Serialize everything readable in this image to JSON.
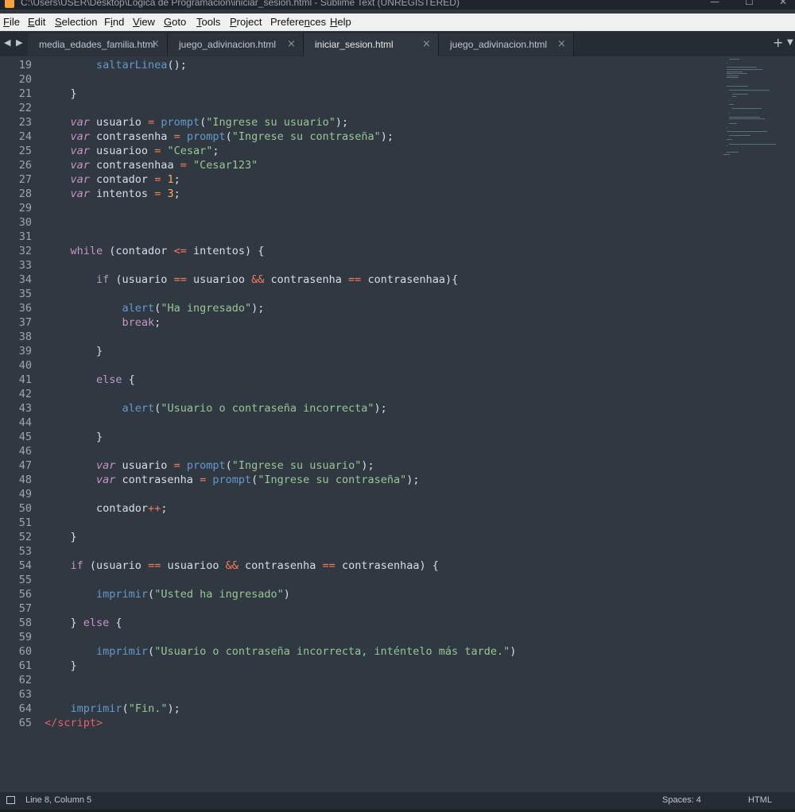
{
  "window": {
    "title": "C:\\Users\\USER\\Desktop\\Lógica de Programación\\iniciar_sesion.html - Sublime Text (UNREGISTERED)",
    "app_icon": "sublime-icon"
  },
  "menu": [
    {
      "ul": "F",
      "rest": "ile"
    },
    {
      "ul": "E",
      "rest": "dit"
    },
    {
      "ul": "S",
      "rest": "election"
    },
    {
      "ul": "",
      "rest": "F",
      "ul2": "i",
      "rest2": "nd"
    },
    {
      "ul": "V",
      "rest": "iew"
    },
    {
      "ul": "",
      "rest": "",
      "ul2": "G",
      "rest2": "oto"
    },
    {
      "ul": "T",
      "rest": "ools"
    },
    {
      "ul": "P",
      "rest": "roject"
    },
    {
      "ul": "",
      "rest": "Prefere",
      "ul2": "n",
      "rest2": "ces"
    },
    {
      "ul": "H",
      "rest": "elp"
    }
  ],
  "tabs": [
    {
      "label": "media_edades_familia.html",
      "active": false
    },
    {
      "label": "juego_adivinacion.html",
      "active": false
    },
    {
      "label": "iniciar_sesion.html",
      "active": true
    },
    {
      "label": "juego_adivinacion.html",
      "active": false
    }
  ],
  "tab_icons": {
    "prev": "◀",
    "next": "▶",
    "new": "+",
    "dropdown": "▼",
    "close": "×"
  },
  "code_lines": [
    {
      "n": "19",
      "t": [
        [
          "fn",
          "        saltarLinea"
        ],
        [
          "plain",
          "();"
        ]
      ]
    },
    {
      "n": "20",
      "t": []
    },
    {
      "n": "21",
      "t": [
        [
          "plain",
          "    }"
        ]
      ]
    },
    {
      "n": "22",
      "t": []
    },
    {
      "n": "23",
      "t": [
        [
          "kw",
          "    var"
        ],
        [
          "plain",
          " usuario "
        ],
        [
          "op",
          "="
        ],
        [
          "plain",
          " "
        ],
        [
          "fn",
          "prompt"
        ],
        [
          "plain",
          "("
        ],
        [
          "st",
          "\"Ingrese su usuario\""
        ],
        [
          "plain",
          ");"
        ]
      ]
    },
    {
      "n": "24",
      "t": [
        [
          "kw",
          "    var"
        ],
        [
          "plain",
          " contrasenha "
        ],
        [
          "op",
          "="
        ],
        [
          "plain",
          " "
        ],
        [
          "fn",
          "prompt"
        ],
        [
          "plain",
          "("
        ],
        [
          "st",
          "\"Ingrese su contraseña\""
        ],
        [
          "plain",
          ");"
        ]
      ]
    },
    {
      "n": "25",
      "t": [
        [
          "kw",
          "    var"
        ],
        [
          "plain",
          " usuarioo "
        ],
        [
          "op",
          "="
        ],
        [
          "plain",
          " "
        ],
        [
          "st",
          "\"Cesar\""
        ],
        [
          "plain",
          ";"
        ]
      ]
    },
    {
      "n": "26",
      "t": [
        [
          "kw",
          "    var"
        ],
        [
          "plain",
          " contrasenhaa "
        ],
        [
          "op",
          "="
        ],
        [
          "plain",
          " "
        ],
        [
          "st",
          "\"Cesar123\""
        ]
      ]
    },
    {
      "n": "27",
      "t": [
        [
          "kw",
          "    var"
        ],
        [
          "plain",
          " contador "
        ],
        [
          "op",
          "="
        ],
        [
          "plain",
          " "
        ],
        [
          "nm",
          "1"
        ],
        [
          "plain",
          ";"
        ]
      ]
    },
    {
      "n": "28",
      "t": [
        [
          "kw",
          "    var"
        ],
        [
          "plain",
          " intentos "
        ],
        [
          "op",
          "="
        ],
        [
          "plain",
          " "
        ],
        [
          "nm",
          "3"
        ],
        [
          "plain",
          ";"
        ]
      ]
    },
    {
      "n": "29",
      "t": []
    },
    {
      "n": "30",
      "t": []
    },
    {
      "n": "31",
      "t": []
    },
    {
      "n": "32",
      "t": [
        [
          "ctl",
          "    while"
        ],
        [
          "plain",
          " (contador "
        ],
        [
          "op",
          "<="
        ],
        [
          "plain",
          " intentos) {"
        ]
      ]
    },
    {
      "n": "33",
      "t": []
    },
    {
      "n": "34",
      "t": [
        [
          "ctl",
          "        if"
        ],
        [
          "plain",
          " (usuario "
        ],
        [
          "op",
          "=="
        ],
        [
          "plain",
          " usuarioo "
        ],
        [
          "op",
          "&&"
        ],
        [
          "plain",
          " contrasenha "
        ],
        [
          "op",
          "=="
        ],
        [
          "plain",
          " contrasenhaa){"
        ]
      ]
    },
    {
      "n": "35",
      "t": []
    },
    {
      "n": "36",
      "t": [
        [
          "fn",
          "            alert"
        ],
        [
          "plain",
          "("
        ],
        [
          "st",
          "\"Ha ingresado\""
        ],
        [
          "plain",
          ");"
        ]
      ]
    },
    {
      "n": "37",
      "t": [
        [
          "ctl",
          "            break"
        ],
        [
          "plain",
          ";"
        ]
      ]
    },
    {
      "n": "38",
      "t": []
    },
    {
      "n": "39",
      "t": [
        [
          "plain",
          "        }"
        ]
      ]
    },
    {
      "n": "40",
      "t": []
    },
    {
      "n": "41",
      "t": [
        [
          "ctl",
          "        else"
        ],
        [
          "plain",
          " {"
        ]
      ]
    },
    {
      "n": "42",
      "t": []
    },
    {
      "n": "43",
      "t": [
        [
          "fn",
          "            alert"
        ],
        [
          "plain",
          "("
        ],
        [
          "st",
          "\"Usuario o contraseña incorrecta\""
        ],
        [
          "plain",
          ");"
        ]
      ]
    },
    {
      "n": "44",
      "t": []
    },
    {
      "n": "45",
      "t": [
        [
          "plain",
          "        }"
        ]
      ]
    },
    {
      "n": "46",
      "t": []
    },
    {
      "n": "47",
      "t": [
        [
          "kw",
          "        var"
        ],
        [
          "plain",
          " usuario "
        ],
        [
          "op",
          "="
        ],
        [
          "plain",
          " "
        ],
        [
          "fn",
          "prompt"
        ],
        [
          "plain",
          "("
        ],
        [
          "st",
          "\"Ingrese su usuario\""
        ],
        [
          "plain",
          ");"
        ]
      ]
    },
    {
      "n": "48",
      "t": [
        [
          "kw",
          "        var"
        ],
        [
          "plain",
          " contrasenha "
        ],
        [
          "op",
          "="
        ],
        [
          "plain",
          " "
        ],
        [
          "fn",
          "prompt"
        ],
        [
          "plain",
          "("
        ],
        [
          "st",
          "\"Ingrese su contraseña\""
        ],
        [
          "plain",
          ");"
        ]
      ]
    },
    {
      "n": "49",
      "t": []
    },
    {
      "n": "50",
      "t": [
        [
          "plain",
          "        contador"
        ],
        [
          "op",
          "++"
        ],
        [
          "plain",
          ";"
        ]
      ]
    },
    {
      "n": "51",
      "t": []
    },
    {
      "n": "52",
      "t": [
        [
          "plain",
          "    }"
        ]
      ]
    },
    {
      "n": "53",
      "t": []
    },
    {
      "n": "54",
      "t": [
        [
          "ctl",
          "    if"
        ],
        [
          "plain",
          " (usuario "
        ],
        [
          "op",
          "=="
        ],
        [
          "plain",
          " usuarioo "
        ],
        [
          "op",
          "&&"
        ],
        [
          "plain",
          " contrasenha "
        ],
        [
          "op",
          "=="
        ],
        [
          "plain",
          " contrasenhaa) {"
        ]
      ]
    },
    {
      "n": "55",
      "t": []
    },
    {
      "n": "56",
      "t": [
        [
          "fn",
          "        imprimir"
        ],
        [
          "plain",
          "("
        ],
        [
          "st",
          "\"Usted ha ingresado\""
        ],
        [
          "plain",
          ")"
        ]
      ]
    },
    {
      "n": "57",
      "t": []
    },
    {
      "n": "58",
      "t": [
        [
          "plain",
          "    } "
        ],
        [
          "ctl",
          "else"
        ],
        [
          "plain",
          " {"
        ]
      ]
    },
    {
      "n": "59",
      "t": []
    },
    {
      "n": "60",
      "t": [
        [
          "fn",
          "        imprimir"
        ],
        [
          "plain",
          "("
        ],
        [
          "st",
          "\"Usuario o contraseña incorrecta, inténtelo más tarde.\""
        ],
        [
          "plain",
          ")"
        ]
      ]
    },
    {
      "n": "61",
      "t": [
        [
          "plain",
          "    }"
        ]
      ]
    },
    {
      "n": "62",
      "t": []
    },
    {
      "n": "63",
      "t": []
    },
    {
      "n": "64",
      "t": [
        [
          "fn",
          "    imprimir"
        ],
        [
          "plain",
          "("
        ],
        [
          "st",
          "\"Fin.\""
        ],
        [
          "plain",
          ");"
        ]
      ]
    },
    {
      "n": "65",
      "t": [
        [
          "tagc",
          "</"
        ],
        [
          "tagc",
          "script"
        ],
        [
          "tagc",
          ">"
        ]
      ]
    }
  ],
  "status": {
    "position": "Line 8, Column 5",
    "indent": "Spaces: 4",
    "syntax": "HTML"
  },
  "colors": {
    "editor_bg": "#303841",
    "keyword": "#c695c6",
    "function": "#6699cc",
    "string": "#99c794",
    "operator": "#f97b58",
    "number": "#f9ae58"
  }
}
